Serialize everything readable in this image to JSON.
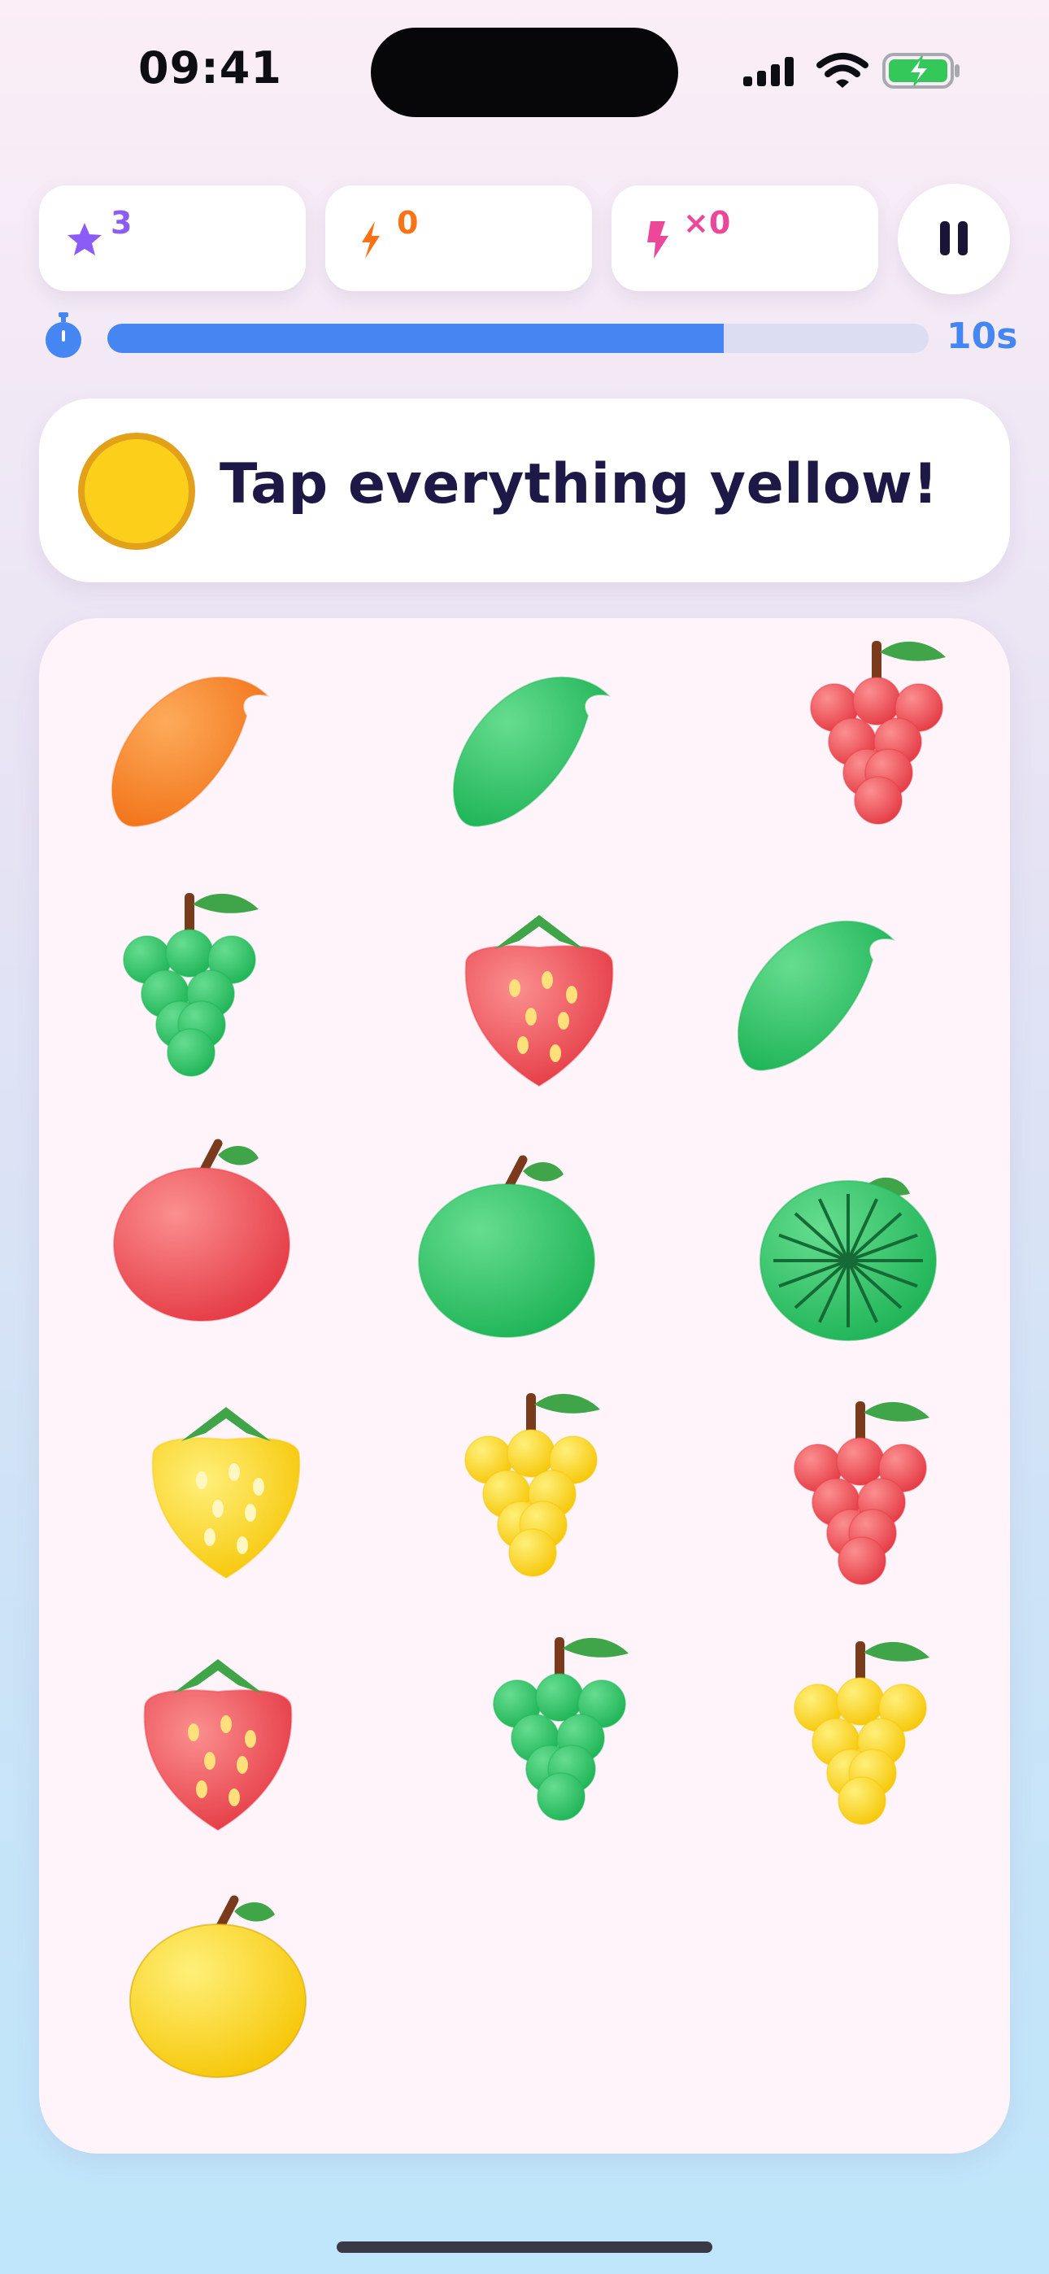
{
  "status_bar": {
    "time": "09:41"
  },
  "hud": {
    "stars": {
      "value": "3",
      "icon": "star-icon",
      "color": "#8b5cf6"
    },
    "streak": {
      "value": "0",
      "icon": "bolt-icon",
      "color": "#f97316"
    },
    "combo": {
      "value": "×0",
      "icon": "lightning-icon",
      "color": "#ec4899"
    },
    "pause": {
      "icon": "pause-icon"
    }
  },
  "timer": {
    "progress": 0.75,
    "label": "10s",
    "color": "#4686f3"
  },
  "instruction": {
    "text": "Tap everything yellow!",
    "target_color": "#fcd01a"
  },
  "board": {
    "items": [
      {
        "fruit": "mango",
        "color": "orange"
      },
      {
        "fruit": "mango",
        "color": "green"
      },
      {
        "fruit": "grapes",
        "color": "red"
      },
      {
        "fruit": "grapes",
        "color": "green"
      },
      {
        "fruit": "strawberry",
        "color": "red"
      },
      {
        "fruit": "mango",
        "color": "green"
      },
      {
        "fruit": "apple",
        "color": "red"
      },
      {
        "fruit": "apple",
        "color": "green"
      },
      {
        "fruit": "watermelon",
        "color": "green"
      },
      {
        "fruit": "strawberry",
        "color": "yellow"
      },
      {
        "fruit": "grapes",
        "color": "yellow"
      },
      {
        "fruit": "grapes",
        "color": "red"
      },
      {
        "fruit": "strawberry",
        "color": "red"
      },
      {
        "fruit": "grapes",
        "color": "green"
      },
      {
        "fruit": "grapes",
        "color": "yellow"
      },
      {
        "fruit": "lemon",
        "color": "yellow"
      }
    ],
    "palette": {
      "orange": {
        "light": "#fdab5a",
        "dark": "#f2741a"
      },
      "green": {
        "light": "#66dd8f",
        "dark": "#1fb457"
      },
      "red": {
        "light": "#fb8f8f",
        "dark": "#e53b45"
      },
      "yellow": {
        "light": "#fff07a",
        "dark": "#f6c708"
      }
    }
  }
}
